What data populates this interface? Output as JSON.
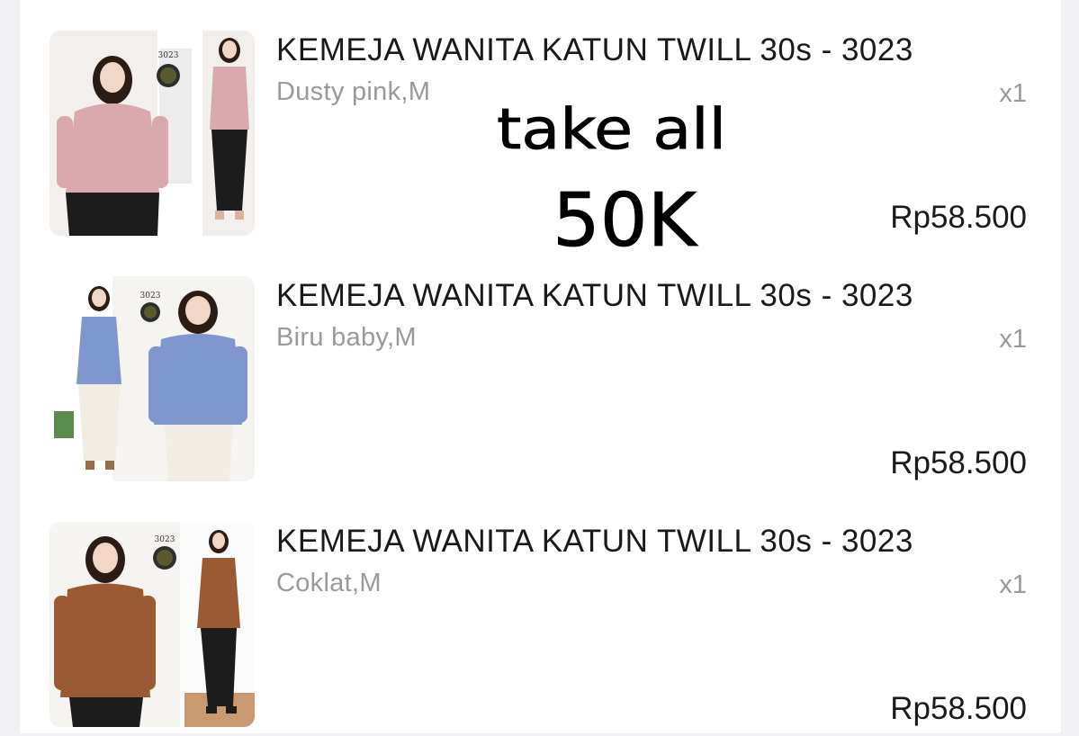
{
  "order_items": [
    {
      "product_name": "KEMEJA WANITA KATUN TWILL 30s - 3023",
      "variant": "Dusty pink,M",
      "quantity": "x1",
      "price": "Rp58.500",
      "thumbnail_code": "3023",
      "shirt_color": "#d9a9ad"
    },
    {
      "product_name": "KEMEJA WANITA KATUN TWILL 30s - 3023",
      "variant": "Biru baby,M",
      "quantity": "x1",
      "price": "Rp58.500",
      "thumbnail_code": "3023",
      "shirt_color": "#7f96cf"
    },
    {
      "product_name": "KEMEJA WANITA KATUN TWILL 30s - 3023",
      "variant": "Coklat,M",
      "quantity": "x1",
      "price": "Rp58.500",
      "thumbnail_code": "3023",
      "shirt_color": "#9a5a33"
    }
  ],
  "handwritten_note": {
    "line1": "take all",
    "line2": "50K"
  }
}
